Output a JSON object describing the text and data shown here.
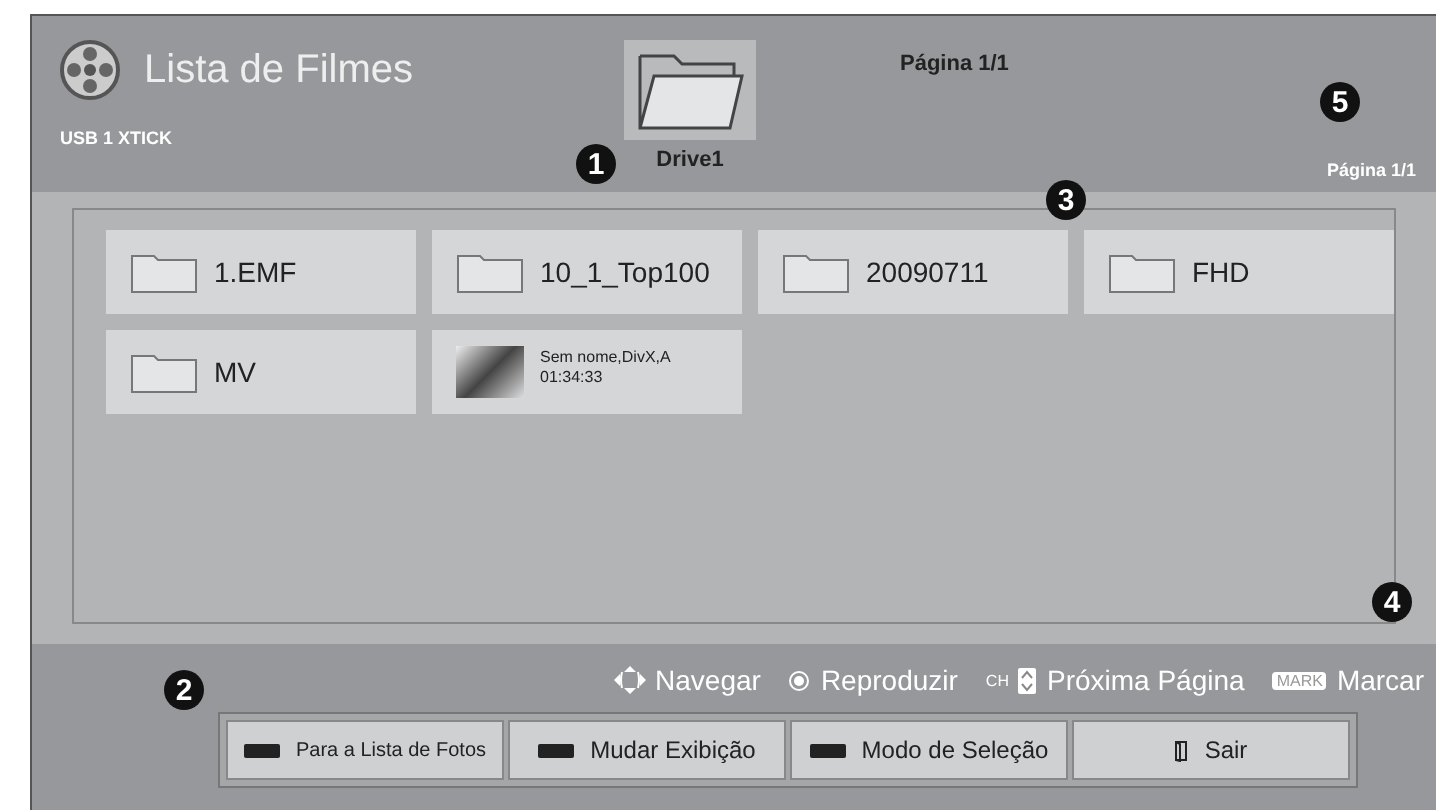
{
  "header": {
    "title": "Lista de Filmes",
    "device": "USB 1 XTICK",
    "drive": {
      "label": "Drive1",
      "selected": true
    },
    "page": "Página 1/1",
    "page_small": "Página 1/1"
  },
  "items": [
    {
      "kind": "folder",
      "name": "1.EMF"
    },
    {
      "kind": "folder",
      "name": "10_1_Top100"
    },
    {
      "kind": "folder",
      "name": "20090711"
    },
    {
      "kind": "folder",
      "name": "FHD"
    },
    {
      "kind": "folder",
      "name": "MV"
    },
    {
      "kind": "video",
      "name": "Sem nome,DivX,A",
      "duration": "01:34:33"
    }
  ],
  "hints": [
    {
      "kind": "arrows",
      "label": "Navegar"
    },
    {
      "kind": "ok",
      "label": "Reproduzir"
    },
    {
      "kind": "ch",
      "key": "CH",
      "label": "Próxima Página"
    },
    {
      "kind": "mark",
      "key": "MARK",
      "label": "Marcar"
    }
  ],
  "buttons": [
    {
      "kind": "color_key",
      "label": "Para a Lista de Fotos"
    },
    {
      "kind": "color_key",
      "label": "Mudar Exibição"
    },
    {
      "kind": "color_key",
      "label": "Modo de Seleção"
    },
    {
      "kind": "exit",
      "label": "Sair"
    }
  ],
  "callouts": [
    "1",
    "2",
    "3",
    "4",
    "5"
  ]
}
